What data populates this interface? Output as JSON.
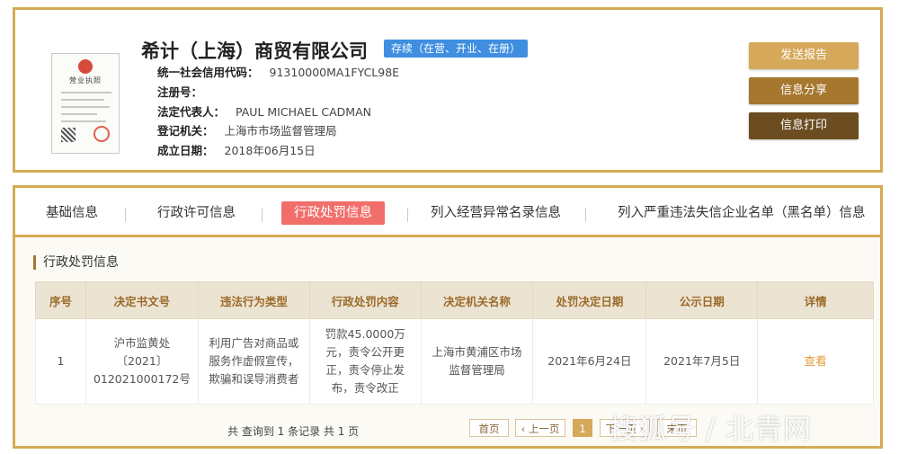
{
  "company": {
    "name": "希计（上海）商贸有限公司",
    "status": "存续（在营、开业、在册）",
    "license_title": "营业执照",
    "fields": [
      {
        "label": "统一社会信用代码：",
        "value": "91310000MA1FYCL98E"
      },
      {
        "label": "注册号：",
        "value": ""
      },
      {
        "label": "法定代表人：",
        "value": "PAUL MICHAEL CADMAN"
      },
      {
        "label": "登记机关：",
        "value": "上海市市场监督管理局"
      },
      {
        "label": "成立日期：",
        "value": "2018年06月15日"
      }
    ]
  },
  "actions": {
    "report": "发送报告",
    "share": "信息分享",
    "print": "信息打印"
  },
  "tabs": [
    {
      "label": "基础信息"
    },
    {
      "label": "行政许可信息"
    },
    {
      "label": "行政处罚信息",
      "active": true
    },
    {
      "label": "列入经营异常名录信息"
    },
    {
      "label": "列入严重违法失信企业名单（黑名单）信息"
    }
  ],
  "section": {
    "title": "行政处罚信息"
  },
  "table": {
    "headers": [
      "序号",
      "决定书文号",
      "违法行为类型",
      "行政处罚内容",
      "决定机关名称",
      "处罚决定日期",
      "公示日期",
      "详情"
    ],
    "rows": [
      {
        "no": "1",
        "doc": "沪市监黄处〔2021〕012021000172号",
        "type": "利用广告对商品或服务作虚假宣传，欺骗和误导消费者",
        "content": "罚款45.0000万元，责令公开更正，责令停止发布，责令改正",
        "authority": "上海市黄浦区市场监督管理局",
        "decision_date": "2021年6月24日",
        "publish_date": "2021年7月5日",
        "detail": "查看"
      }
    ]
  },
  "pagination": {
    "summary": "共 查询到 1 条记录 共 1 页",
    "first": "首页",
    "prev": "‹ 上一页",
    "current": "1",
    "next": "下一页 ›",
    "last": "末页"
  },
  "watermark": "搜狐号 / 北青网",
  "colors": {
    "gold_border": "#d4aa55",
    "status_blue": "#3f8ee0",
    "active_tab": "#f16e6a",
    "btn_report": "#d6a85a",
    "btn_share": "#a6772f",
    "btn_print": "#6b4d21"
  }
}
